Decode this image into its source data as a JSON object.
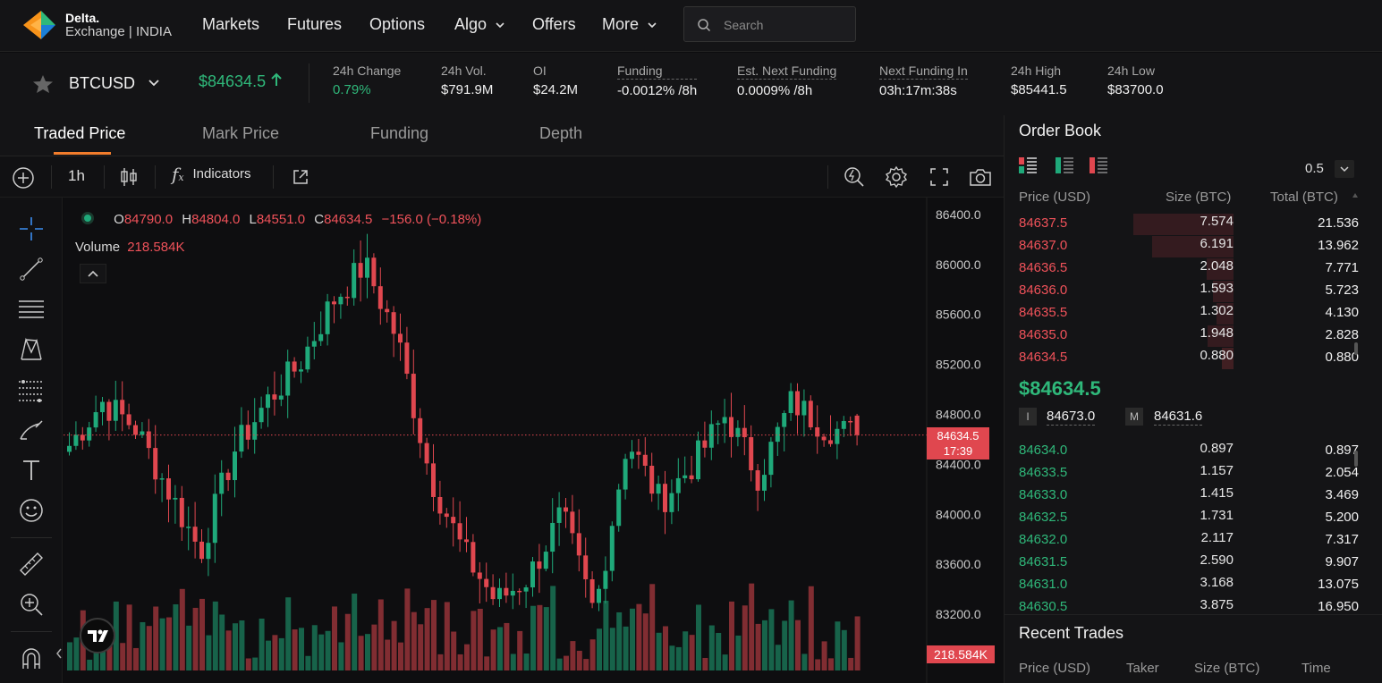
{
  "nav": {
    "brand_line1": "Delta.",
    "brand_line2": "Exchange | INDIA",
    "items": [
      "Markets",
      "Futures",
      "Options",
      "Algo",
      "Offers",
      "More"
    ],
    "search_placeholder": "Search"
  },
  "ticker": {
    "symbol": "BTCUSD",
    "last_price": "$84634.5",
    "stats": [
      {
        "label": "24h Change",
        "value": "0.79%"
      },
      {
        "label": "24h Vol.",
        "value": "$791.9M"
      },
      {
        "label": "OI",
        "value": "$24.2M"
      },
      {
        "label": "Funding",
        "value": "-0.0012% /8h"
      },
      {
        "label": "Est. Next Funding",
        "value": "0.0009% /8h"
      },
      {
        "label": "Next Funding In",
        "value": "03h:17m:38s"
      },
      {
        "label": "24h High",
        "value": "$85441.5"
      },
      {
        "label": "24h Low",
        "value": "$83700.0"
      }
    ]
  },
  "tabs": [
    "Traded Price",
    "Mark Price",
    "Funding",
    "Depth"
  ],
  "toolbar": {
    "interval": "1h",
    "indicators": "Indicators"
  },
  "chart": {
    "ohlc": {
      "o_label": "O",
      "o": "84790.0",
      "h_label": "H",
      "h": "84804.0",
      "l_label": "L",
      "l": "84551.0",
      "c_label": "C",
      "c": "84634.5",
      "change": "−156.0 (−0.18%)"
    },
    "volume_label": "Volume",
    "volume_value": "218.584K",
    "price_tag": "84634.5",
    "countdown": "17:39",
    "volume_tag": "218.584K",
    "colors": {
      "up": "#1fa97a",
      "down": "#e0474f",
      "bg": "#0e0e10"
    }
  },
  "chart_data": {
    "type": "candlestick",
    "y_axis_ticks": [
      "86400.0",
      "86000.0",
      "85600.0",
      "85200.0",
      "84800.0",
      "84400.0",
      "84000.0",
      "83600.0",
      "83200.0"
    ],
    "ylim": [
      83100,
      86450
    ],
    "current_price": 84634.5,
    "ohlc_last": {
      "open": 84790.0,
      "high": 84804.0,
      "low": 84551.0,
      "close": 84634.5
    },
    "last_volume": "218.584K"
  },
  "orderbook": {
    "title": "Order Book",
    "tick_size": "0.5",
    "headers": {
      "price": "Price (USD)",
      "size": "Size (BTC)",
      "total": "Total (BTC)"
    },
    "asks": [
      {
        "price": "84637.5",
        "size": "7.574",
        "total": "21.536"
      },
      {
        "price": "84637.0",
        "size": "6.191",
        "total": "13.962"
      },
      {
        "price": "84636.5",
        "size": "2.048",
        "total": "7.771"
      },
      {
        "price": "84636.0",
        "size": "1.593",
        "total": "5.723"
      },
      {
        "price": "84635.5",
        "size": "1.302",
        "total": "4.130"
      },
      {
        "price": "84635.0",
        "size": "1.948",
        "total": "2.828"
      },
      {
        "price": "84634.5",
        "size": "0.880",
        "total": "0.880"
      }
    ],
    "last_price": "$84634.5",
    "index_label": "I",
    "index_price": "84673.0",
    "mark_label": "M",
    "mark_price": "84631.6",
    "bids": [
      {
        "price": "84634.0",
        "size": "0.897",
        "total": "0.897"
      },
      {
        "price": "84633.5",
        "size": "1.157",
        "total": "2.054"
      },
      {
        "price": "84633.0",
        "size": "1.415",
        "total": "3.469"
      },
      {
        "price": "84632.5",
        "size": "1.731",
        "total": "5.200"
      },
      {
        "price": "84632.0",
        "size": "2.117",
        "total": "7.317"
      },
      {
        "price": "84631.5",
        "size": "2.590",
        "total": "9.907"
      },
      {
        "price": "84631.0",
        "size": "3.168",
        "total": "13.075"
      },
      {
        "price": "84630.5",
        "size": "3.875",
        "total": "16.950"
      }
    ]
  },
  "recent_trades": {
    "title": "Recent Trades",
    "headers": {
      "price": "Price (USD)",
      "taker": "Taker",
      "size": "Size (BTC)",
      "time": "Time"
    }
  }
}
